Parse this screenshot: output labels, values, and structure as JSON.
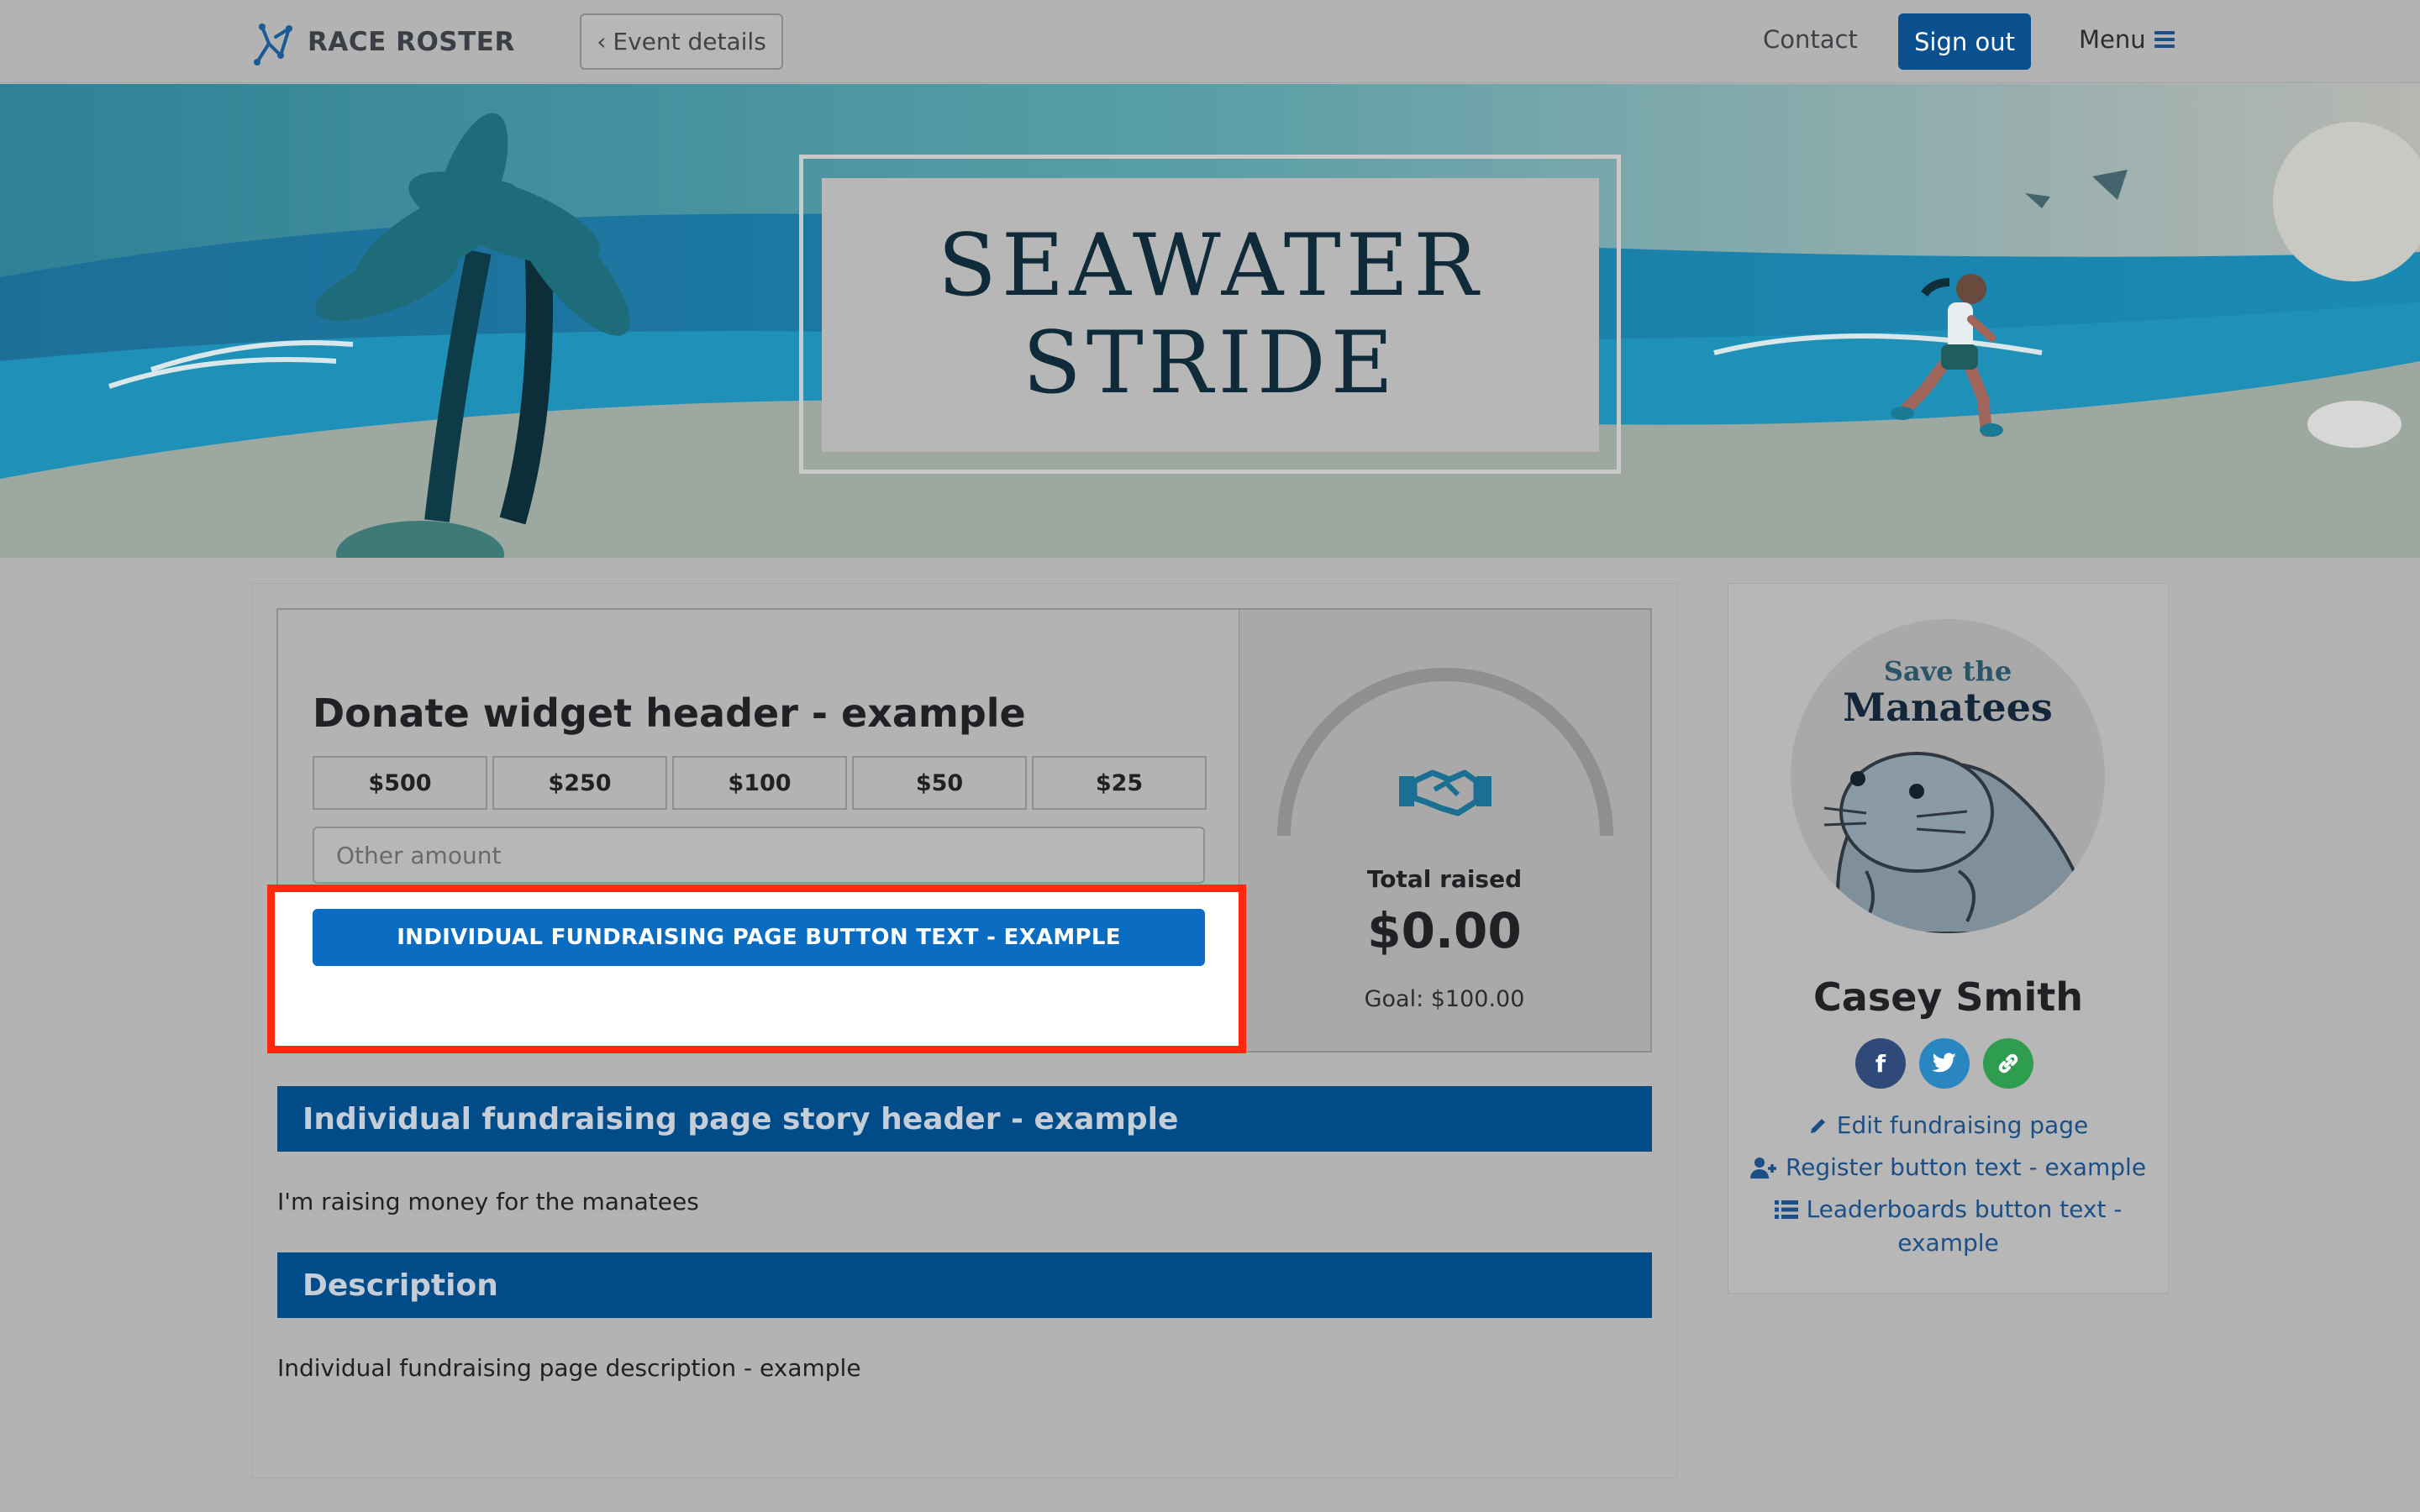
{
  "nav": {
    "brand": "RACE ROSTER",
    "event_details": "Event details",
    "contact": "Contact",
    "sign_out": "Sign out",
    "menu": "Menu"
  },
  "banner": {
    "title_line1": "SEAWATER",
    "title_line2": "STRIDE"
  },
  "donate": {
    "header": "Donate widget header - example",
    "amounts": [
      "$500",
      "$250",
      "$100",
      "$50",
      "$25"
    ],
    "other_placeholder": "Other amount",
    "fund_button": "INDIVIDUAL FUNDRAISING PAGE BUTTON TEXT - EXAMPLE",
    "total_label": "Total raised",
    "total_value": "$0.00",
    "goal": "Goal: $100.00",
    "progress_fraction": 0.0,
    "icon": "handshake-icon"
  },
  "story": {
    "header": "Individual fundraising page story header - example",
    "text": "I'm raising money for the manatees"
  },
  "description": {
    "header": "Description",
    "text": "Individual fundraising page description - example"
  },
  "sidebar": {
    "avatar_line1": "Save the",
    "avatar_line2": "Manatees",
    "name": "Casey Smith",
    "socials": [
      "facebook-icon",
      "twitter-icon",
      "link-icon"
    ],
    "edit_link": "Edit fundraising page",
    "register_link": "Register button text - example",
    "leaderboards_link_line1": "Leaderboards button text -",
    "leaderboards_link_line2": "example"
  },
  "colors": {
    "primary_button": "#0a6dc2",
    "section_bar": "#004c88",
    "highlight": "#ff2a0d",
    "sign_out": "#0a4f8e"
  }
}
